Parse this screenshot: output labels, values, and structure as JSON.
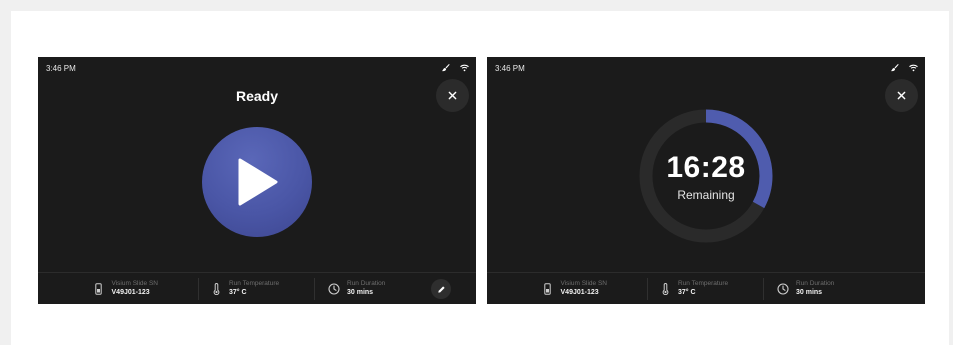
{
  "screens": [
    {
      "id": "ready",
      "status_time": "3:46 PM",
      "title": "Ready",
      "footer": {
        "slide_label": "Visium Slide SN",
        "slide_value": "V49J01-123",
        "temp_label": "Run Temperature",
        "temp_value": "37° C",
        "duration_label": "Run Duration",
        "duration_value": "30 mins"
      }
    },
    {
      "id": "running",
      "status_time": "3:46 PM",
      "timer_value": "16:28",
      "timer_label": "Remaining",
      "progress_fraction": 0.33,
      "footer": {
        "slide_label": "Visium Slide SN",
        "slide_value": "V49J01-123",
        "temp_label": "Run Temperature",
        "temp_value": "37° C",
        "duration_label": "Run Duration",
        "duration_value": "30 mins"
      }
    }
  ],
  "colors": {
    "screen_bg": "#1b1b1b",
    "accent": "#4f5cae",
    "ring_track": "#2a2a2a"
  },
  "icons": [
    "brush-icon",
    "wifi-icon",
    "close-icon",
    "play-icon",
    "slide-icon",
    "thermometer-icon",
    "clock-icon",
    "pencil-icon"
  ]
}
